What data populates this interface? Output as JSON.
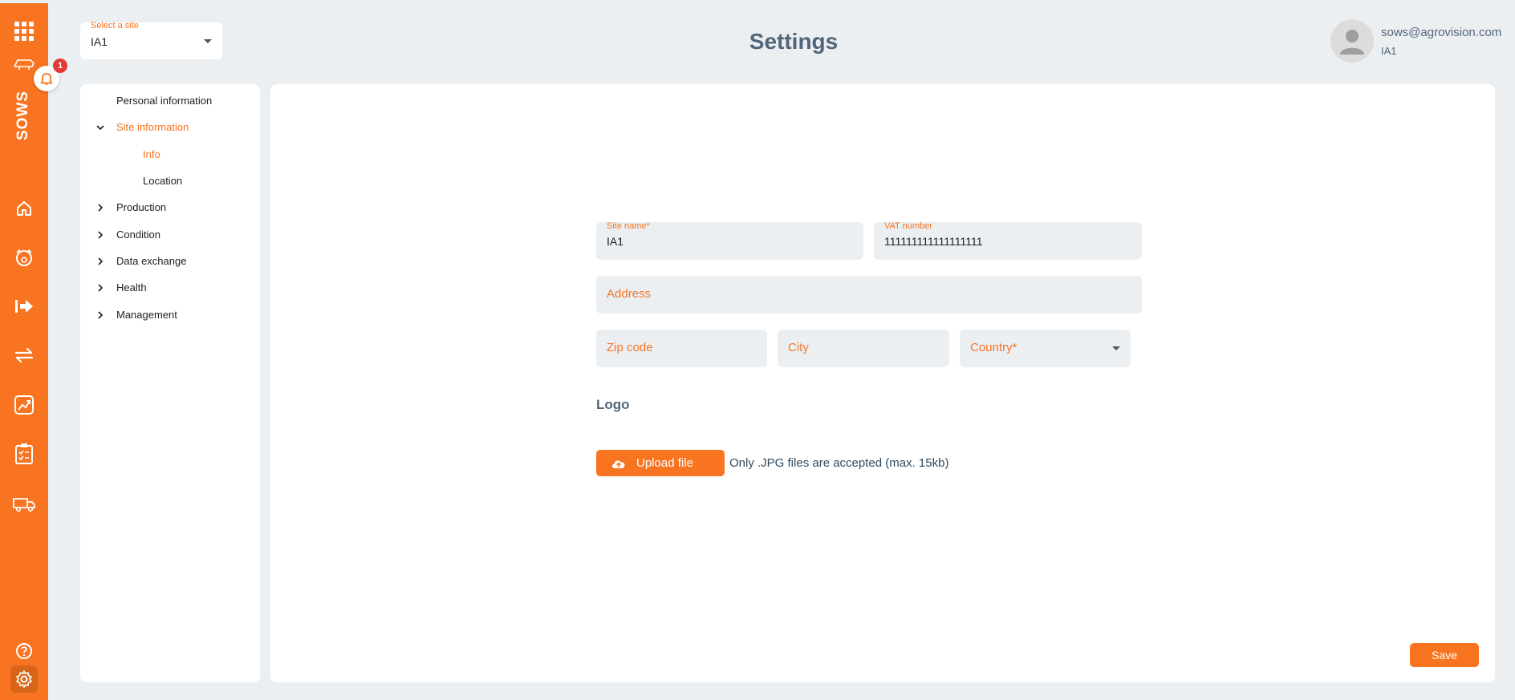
{
  "rail": {
    "brand": "SOWS",
    "notification_count": "1",
    "accent": "#f87421",
    "icons": [
      "apps-grid-icon",
      "pig-farm-icon",
      "bell-icon",
      "home-icon",
      "pig-icon",
      "exit-icon",
      "transfer-icon",
      "chart-icon",
      "clipboard-icon",
      "truck-icon",
      "help-icon",
      "gear-icon"
    ]
  },
  "header": {
    "site_select_label": "Select a site",
    "site_select_value": "IA1",
    "title": "Settings",
    "user_email": "sows@agrovision.com",
    "user_site": "IA1"
  },
  "tree": {
    "items": [
      {
        "label": "Personal information"
      },
      {
        "label": "Site information"
      },
      {
        "label": "Info"
      },
      {
        "label": "Location"
      },
      {
        "label": "Production"
      },
      {
        "label": "Condition"
      },
      {
        "label": "Data exchange"
      },
      {
        "label": "Health"
      },
      {
        "label": "Management"
      }
    ]
  },
  "form": {
    "site_name_label": "Site name*",
    "site_name_value": "IA1",
    "vat_label": "VAT number",
    "vat_value": "111111111111111111",
    "address_placeholder": "Address",
    "zip_placeholder": "Zip code",
    "city_placeholder": "City",
    "country_placeholder": "Country*",
    "logo_label": "Logo",
    "upload_label": "Upload file",
    "upload_hint": "Only .JPG files are accepted (max. 15kb)",
    "save_label": "Save"
  }
}
